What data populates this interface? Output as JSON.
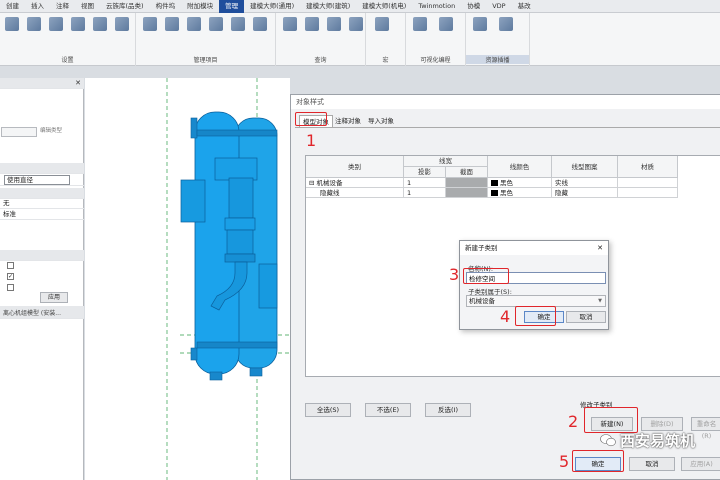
{
  "ribbon": {
    "tabs": [
      "创建",
      "插入",
      "注释",
      "视图",
      "云族库(品类)",
      "构件坞",
      "附加模块",
      "管理",
      "建模大师(通用)",
      "建模大师(建筑)",
      "建模大师(机电)",
      "Twinmotion",
      "协模",
      "VDP",
      "基改"
    ],
    "active_tab_index": 7,
    "groups": [
      {
        "label": "设置",
        "highlight": false
      },
      {
        "label": "管理项目",
        "highlight": false
      },
      {
        "label": "查询",
        "highlight": false
      },
      {
        "label": "宏",
        "highlight": false
      },
      {
        "label": "可视化编程",
        "highlight": false
      },
      {
        "label": "资源插播",
        "highlight": true
      }
    ]
  },
  "left_panel": {
    "filter_button": "编辑类型",
    "values": [
      "使用直径",
      "无",
      "标准"
    ],
    "apply_button": "应用",
    "browser_title": "离心机组模型 (安装...",
    "close_icon": "✕"
  },
  "dialog": {
    "title": "对象样式",
    "tabs": [
      "模型对象",
      "注释对象",
      "导入对象"
    ],
    "table": {
      "headers": {
        "category": "类别",
        "line_weight": "线宽",
        "projection": "投影",
        "cut": "截面",
        "line_color": "线颜色",
        "line_pattern": "线型图案",
        "material": "材质"
      },
      "rows": [
        {
          "category": "机械设备",
          "expander": "⊟",
          "projection": "1",
          "cut": "",
          "color": "黑色",
          "pattern": "实线",
          "material": ""
        },
        {
          "category": "隐藏线",
          "expander": "",
          "projection": "1",
          "cut": "",
          "color": "黑色",
          "pattern": "隐藏",
          "material": ""
        }
      ]
    },
    "buttons": {
      "select_all": "全选(S)",
      "select_none": "不选(E)",
      "invert": "反选(I)"
    },
    "modify_group_label": "修改子类别",
    "new_button": "新建(N)",
    "delete_button": "删除(D)",
    "rename_button": "重命名(R)",
    "ok_button": "确定",
    "cancel_button": "取消",
    "apply_button": "应用(A)"
  },
  "sub_dialog": {
    "title": "新建子类别",
    "close_icon": "✕",
    "name_label": "名称(N):",
    "name_value": "检修空间",
    "parent_label": "子类别属于(S):",
    "parent_value": "机械设备",
    "ok_button": "确定",
    "cancel_button": "取消"
  },
  "annotations": [
    "1",
    "2",
    "3",
    "4",
    "5"
  ],
  "watermark": {
    "text": "西安易筑机"
  },
  "colors": {
    "accent_tab": "#1f4e9c",
    "equipment": "#1ba3ec",
    "annotation_red": "#e0262b"
  }
}
